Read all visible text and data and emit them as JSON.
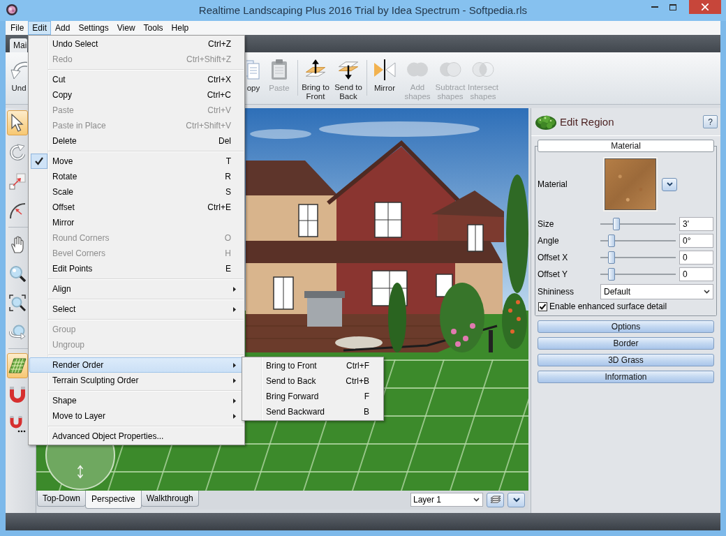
{
  "window": {
    "title": "Realtime Landscaping Plus 2016 Trial by Idea Spectrum - Softpedia.rls"
  },
  "menu_bar": [
    {
      "label": "File",
      "selected": false
    },
    {
      "label": "Edit",
      "selected": true
    },
    {
      "label": "Add",
      "selected": false
    },
    {
      "label": "Settings",
      "selected": false
    },
    {
      "label": "View",
      "selected": false
    },
    {
      "label": "Tools",
      "selected": false
    },
    {
      "label": "Help",
      "selected": false
    }
  ],
  "ribbon_tabs": [
    {
      "label": "Mai",
      "selected": true
    }
  ],
  "toolbar": {
    "groups": [
      {
        "items": [
          {
            "kind": "undo",
            "label": "Und",
            "disabled": false
          }
        ]
      },
      {
        "items": [
          {
            "kind": "copy",
            "label": "opy",
            "disabled": false
          },
          {
            "kind": "paste",
            "label": "Paste",
            "disabled": true
          }
        ]
      },
      {
        "items": [
          {
            "kind": "bring_to_front",
            "label": "Bring to Front",
            "disabled": false
          },
          {
            "kind": "send_to_back",
            "label": "Send to Back",
            "disabled": false
          }
        ]
      },
      {
        "items": [
          {
            "kind": "mirror",
            "label": "Mirror",
            "disabled": false
          },
          {
            "kind": "add_shapes",
            "label": "Add shapes",
            "disabled": true
          },
          {
            "kind": "subtract_shapes",
            "label": "Subtract shapes",
            "disabled": true
          },
          {
            "kind": "intersect_shapes",
            "label": "Intersect shapes",
            "disabled": true
          }
        ]
      }
    ]
  },
  "tool_strip": {
    "groups": [
      {
        "items": [
          {
            "kind": "select",
            "selected": true
          },
          {
            "kind": "rotate",
            "selected": false
          },
          {
            "kind": "scale",
            "selected": false
          },
          {
            "kind": "offset",
            "selected": false
          }
        ]
      },
      {
        "items": [
          {
            "kind": "pan",
            "selected": false
          },
          {
            "kind": "zoom",
            "selected": false
          },
          {
            "kind": "zoom_extents",
            "selected": false
          },
          {
            "kind": "orbit",
            "selected": false
          }
        ]
      },
      {
        "items": [
          {
            "kind": "grid",
            "selected": true
          },
          {
            "kind": "magnet",
            "selected": false
          },
          {
            "kind": "magnet_options",
            "selected": false
          }
        ]
      }
    ]
  },
  "view_tabs": [
    {
      "label": "Top-Down",
      "selected": false
    },
    {
      "label": "Perspective",
      "selected": true
    },
    {
      "label": "Walkthrough",
      "selected": false
    }
  ],
  "layer_select": {
    "value": "Layer 1"
  },
  "edit_panel": {
    "title": "Edit Region",
    "help_label": "?",
    "material_section": {
      "header": "Material",
      "material_label": "Material",
      "sliders": [
        {
          "name": "Size",
          "level": 0.18,
          "value": "3'"
        },
        {
          "name": "Angle",
          "level": 0.11,
          "value": "0°"
        },
        {
          "name": "Offset X",
          "level": 0.11,
          "value": "0"
        },
        {
          "name": "Offset Y",
          "level": 0.11,
          "value": "0"
        }
      ],
      "shininess": {
        "label": "Shininess",
        "value": "Default"
      },
      "surface_detail": {
        "label": "Enable enhanced surface detail",
        "checked": true
      }
    },
    "buttons": [
      "Options",
      "Border",
      "3D Grass",
      "Information"
    ]
  },
  "edit_menu": {
    "groups": [
      {
        "items": [
          {
            "kind": "command",
            "label": "Undo Select",
            "shortcut": "Ctrl+Z",
            "disabled": false,
            "checked": false,
            "selected": false
          },
          {
            "kind": "command",
            "label": "Redo",
            "shortcut": "Ctrl+Shift+Z",
            "disabled": true,
            "checked": false,
            "selected": false
          }
        ]
      },
      {
        "items": [
          {
            "kind": "command",
            "label": "Cut",
            "shortcut": "Ctrl+X",
            "disabled": false,
            "checked": false,
            "selected": false
          },
          {
            "kind": "command",
            "label": "Copy",
            "shortcut": "Ctrl+C",
            "disabled": false,
            "checked": false,
            "selected": false
          },
          {
            "kind": "command",
            "label": "Paste",
            "shortcut": "Ctrl+V",
            "disabled": true,
            "checked": false,
            "selected": false
          },
          {
            "kind": "command",
            "label": "Paste in Place",
            "shortcut": "Ctrl+Shift+V",
            "disabled": true,
            "checked": false,
            "selected": false
          },
          {
            "kind": "command",
            "label": "Delete",
            "shortcut": "Del",
            "disabled": false,
            "checked": false,
            "selected": false
          }
        ]
      },
      {
        "items": [
          {
            "kind": "command",
            "label": "Move",
            "shortcut": "T",
            "disabled": false,
            "checked": true,
            "selected": false
          },
          {
            "kind": "command",
            "label": "Rotate",
            "shortcut": "R",
            "disabled": false,
            "checked": false,
            "selected": false
          },
          {
            "kind": "command",
            "label": "Scale",
            "shortcut": "S",
            "disabled": false,
            "checked": false,
            "selected": false
          },
          {
            "kind": "command",
            "label": "Offset",
            "shortcut": "Ctrl+E",
            "disabled": false,
            "checked": false,
            "selected": false
          },
          {
            "kind": "command",
            "label": "Mirror",
            "disabled": false,
            "checked": false,
            "selected": false
          },
          {
            "kind": "command",
            "label": "Round Corners",
            "shortcut": "O",
            "disabled": true,
            "checked": false,
            "selected": false
          },
          {
            "kind": "command",
            "label": "Bevel Corners",
            "shortcut": "H",
            "disabled": true,
            "checked": false,
            "selected": false
          },
          {
            "kind": "command",
            "label": "Edit Points",
            "shortcut": "E",
            "disabled": false,
            "checked": false,
            "selected": false
          }
        ]
      },
      {
        "items": [
          {
            "kind": "submenu",
            "label": "Align",
            "disabled": false,
            "checked": false,
            "selected": false
          }
        ]
      },
      {
        "items": [
          {
            "kind": "submenu",
            "label": "Select",
            "disabled": false,
            "checked": false,
            "selected": false
          }
        ]
      },
      {
        "items": [
          {
            "kind": "command",
            "label": "Group",
            "disabled": true,
            "checked": false,
            "selected": false
          },
          {
            "kind": "command",
            "label": "Ungroup",
            "disabled": true,
            "checked": false,
            "selected": false
          }
        ]
      },
      {
        "items": [
          {
            "kind": "submenu",
            "label": "Render Order",
            "disabled": false,
            "checked": false,
            "selected": true
          },
          {
            "kind": "submenu",
            "label": "Terrain Sculpting Order",
            "disabled": false,
            "checked": false,
            "selected": false
          }
        ]
      },
      {
        "items": [
          {
            "kind": "submenu",
            "label": "Shape",
            "disabled": false,
            "checked": false,
            "selected": false
          },
          {
            "kind": "submenu",
            "label": "Move to Layer",
            "disabled": false,
            "checked": false,
            "selected": false
          }
        ]
      },
      {
        "items": [
          {
            "kind": "command",
            "label": "Advanced Object Properties...",
            "disabled": false,
            "checked": false,
            "selected": false
          }
        ]
      }
    ]
  },
  "render_order_submenu": {
    "items": [
      {
        "label": "Bring to Front",
        "shortcut": "Ctrl+F",
        "selected": false
      },
      {
        "label": "Send to Back",
        "shortcut": "Ctrl+B",
        "selected": false
      },
      {
        "label": "Bring Forward",
        "shortcut": "F",
        "selected": false
      },
      {
        "label": "Send Backward",
        "shortcut": "B",
        "selected": false
      }
    ]
  }
}
